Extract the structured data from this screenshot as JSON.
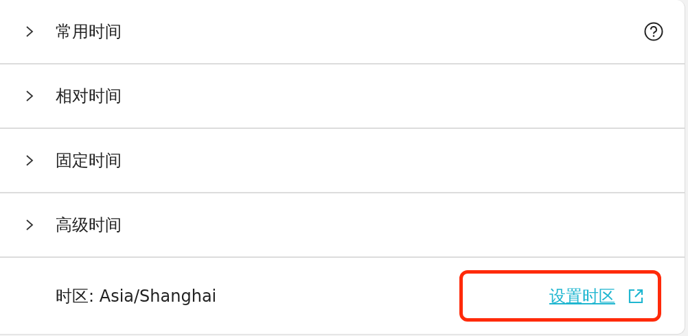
{
  "sections": [
    {
      "label": "常用时间",
      "expanded": false,
      "help_icon": true
    },
    {
      "label": "相对时间",
      "expanded": false,
      "help_icon": false
    },
    {
      "label": "固定时间",
      "expanded": false,
      "help_icon": false
    },
    {
      "label": "高级时间",
      "expanded": false,
      "help_icon": false
    }
  ],
  "footer": {
    "timezone": "时区: Asia/Shanghai",
    "link": "设置时区",
    "highlighted": true
  }
}
